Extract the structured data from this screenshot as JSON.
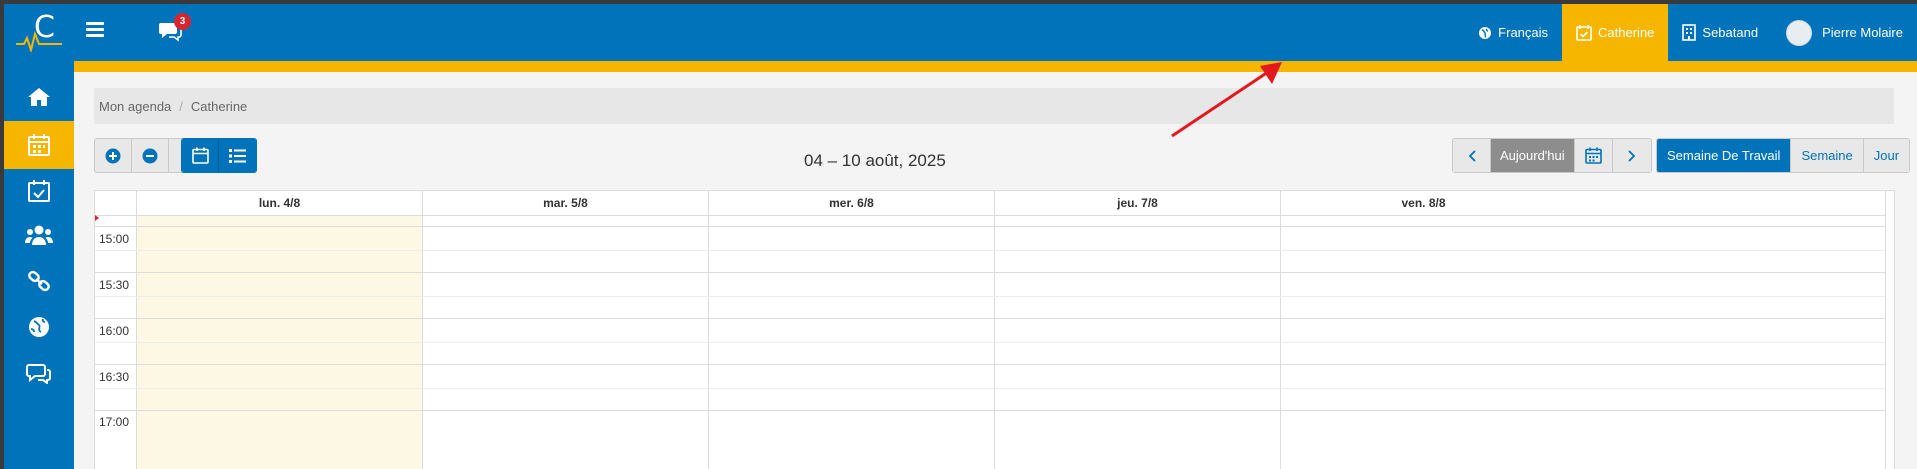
{
  "header": {
    "logo_letter": "C",
    "chat_badge": "3",
    "language": "Français",
    "agenda_user": "Catherine",
    "organization": "Sebatand",
    "current_user": "Pierre Molaire"
  },
  "sidebar": {
    "items": [
      {
        "icon": "home-icon"
      },
      {
        "icon": "calendar-icon",
        "active": true
      },
      {
        "icon": "calendar-check-icon"
      },
      {
        "icon": "users-icon"
      },
      {
        "icon": "link-icon"
      },
      {
        "icon": "globe-icon"
      },
      {
        "icon": "chat-icon"
      }
    ]
  },
  "breadcrumb": {
    "root": "Mon agenda",
    "separator": "/",
    "current": "Catherine"
  },
  "toolbar": {
    "date_range": "04 – 10 août, 2025",
    "today_label": "Aujourd'hui",
    "views": {
      "work_week": "Semaine De Travail",
      "week": "Semaine",
      "day": "Jour"
    }
  },
  "calendar": {
    "days": [
      "lun. 4/8",
      "mar. 5/8",
      "mer. 6/8",
      "jeu. 7/8",
      "ven. 8/8"
    ],
    "times": [
      "15:00",
      "15:30",
      "16:00",
      "16:30",
      "17:00"
    ]
  },
  "colors": {
    "primary": "#0073bb",
    "accent": "#f6b600",
    "today_column": "#fcf8e3",
    "badge": "#d9232d"
  }
}
